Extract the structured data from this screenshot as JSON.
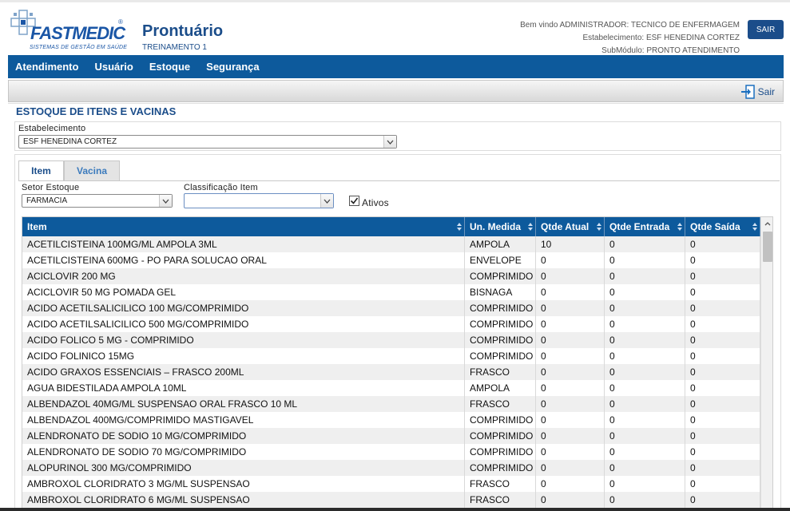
{
  "app": {
    "logo_brand": "FASTMEDIC",
    "logo_tagline": "SISTEMAS DE GESTÃO EM SAÚDE",
    "title": "Prontuário",
    "subtitle": "TREINAMENTO 1",
    "welcome": "Bem vindo ADMINISTRADOR: TECNICO DE ENFERMAGEM",
    "establishment": "Estabelecimento: ESF HENEDINA CORTEZ",
    "submodule": "SubMódulo: PRONTO ATENDIMENTO",
    "logout_button": "SAIR"
  },
  "nav": {
    "items": [
      "Atendimento",
      "Usuário",
      "Estoque",
      "Segurança"
    ]
  },
  "toolbar": {
    "exit_label": "Sair"
  },
  "page": {
    "section_title": "ESTOQUE DE ITENS E VACINAS",
    "establishment_label": "Estabelecimento",
    "establishment_value": "ESF HENEDINA CORTEZ"
  },
  "tabs": [
    {
      "label": "Item",
      "active": true
    },
    {
      "label": "Vacina",
      "active": false
    }
  ],
  "filters": {
    "setor_label": "Setor Estoque",
    "setor_value": "FARMACIA",
    "classificacao_label": "Classificação Item",
    "classificacao_value": "",
    "ativos_label": "Ativos",
    "ativos_checked": true
  },
  "table": {
    "columns": [
      "Item",
      "Un. Medida",
      "Qtde Atual",
      "Qtde Entrada",
      "Qtde Saída"
    ],
    "rows": [
      [
        "ACETILCISTEINA 100MG/ML AMPOLA 3ML",
        "AMPOLA",
        "10",
        "0",
        "0"
      ],
      [
        "ACETILCISTEINA 600MG - PO PARA SOLUCAO ORAL",
        "ENVELOPE",
        "0",
        "0",
        "0"
      ],
      [
        "ACICLOVIR 200 MG",
        "COMPRIMIDO",
        "0",
        "0",
        "0"
      ],
      [
        "ACICLOVIR 50 MG POMADA GEL",
        "BISNAGA",
        "0",
        "0",
        "0"
      ],
      [
        "ACIDO ACETILSALICILICO 100 MG/COMPRIMIDO",
        "COMPRIMIDO",
        "0",
        "0",
        "0"
      ],
      [
        "ACIDO ACETILSALICILICO 500 MG/COMPRIMIDO",
        "COMPRIMIDO",
        "0",
        "0",
        "0"
      ],
      [
        "ACIDO FOLICO 5 MG - COMPRIMIDO",
        "COMPRIMIDO",
        "0",
        "0",
        "0"
      ],
      [
        "ACIDO FOLINICO 15MG",
        "COMPRIMIDO",
        "0",
        "0",
        "0"
      ],
      [
        "ACIDO GRAXOS ESSENCIAIS – FRASCO 200ML",
        "FRASCO",
        "0",
        "0",
        "0"
      ],
      [
        "AGUA BIDESTILADA AMPOLA 10ML",
        "AMPOLA",
        "0",
        "0",
        "0"
      ],
      [
        "ALBENDAZOL 40MG/ML SUSPENSAO ORAL FRASCO 10 ML",
        "FRASCO",
        "0",
        "0",
        "0"
      ],
      [
        "ALBENDAZOL 400MG/COMPRIMIDO MASTIGAVEL",
        "COMPRIMIDO",
        "0",
        "0",
        "0"
      ],
      [
        "ALENDRONATO DE SODIO 10 MG/COMPRIMIDO",
        "COMPRIMIDO",
        "0",
        "0",
        "0"
      ],
      [
        "ALENDRONATO DE SODIO 70 MG/COMPRIMIDO",
        "COMPRIMIDO",
        "0",
        "0",
        "0"
      ],
      [
        "ALOPURINOL 300 MG/COMPRIMIDO",
        "COMPRIMIDO",
        "0",
        "0",
        "0"
      ],
      [
        "AMBROXOL CLORIDRATO 3 MG/ML SUSPENSAO",
        "FRASCO",
        "0",
        "0",
        "0"
      ],
      [
        "AMBROXOL CLORIDRATO 6 MG/ML SUSPENSAO",
        "FRASCO",
        "0",
        "0",
        "0"
      ]
    ]
  },
  "colors": {
    "primary": "#0d5a9c",
    "title": "#1b4d8a",
    "row_alt": "#efefef"
  }
}
